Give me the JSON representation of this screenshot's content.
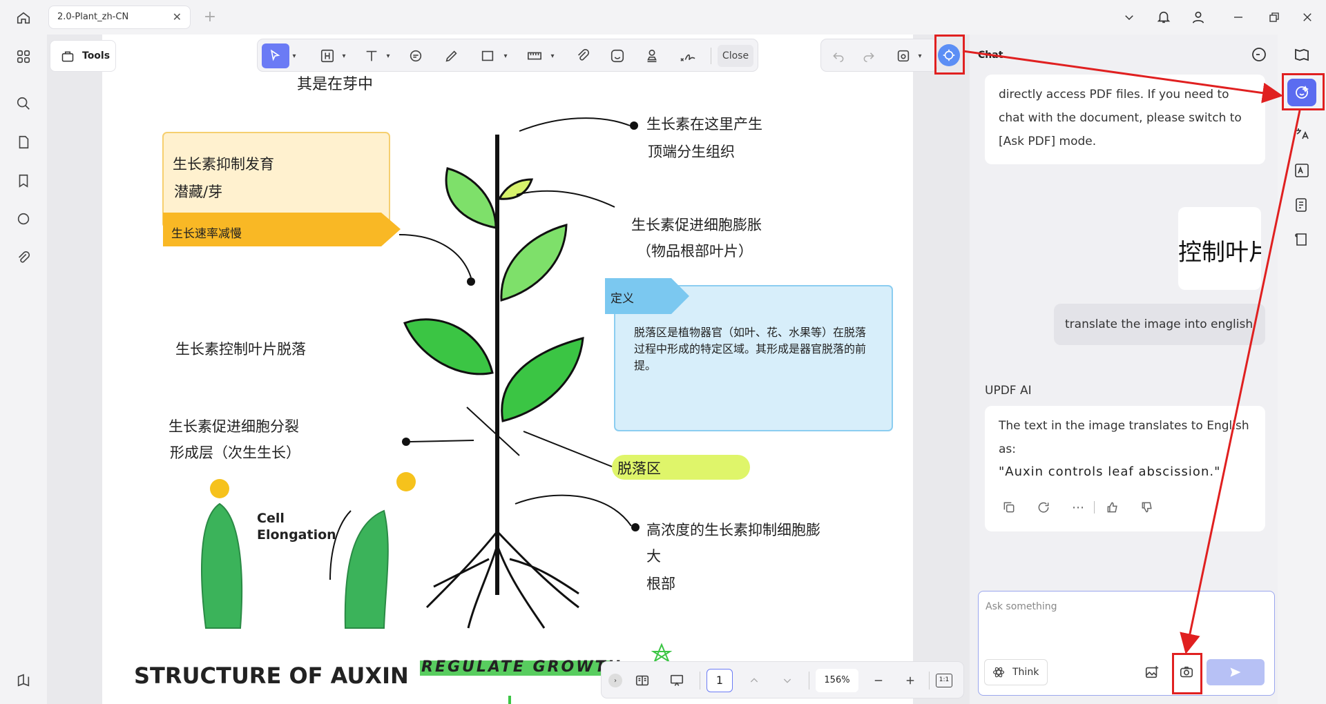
{
  "titlebar": {
    "tab_title": "2.0-Plant_zh-CN",
    "tab_close": "✕",
    "new_tab": "+"
  },
  "toolbar": {
    "tools_label": "Tools",
    "close_label": "Close"
  },
  "chat": {
    "header": "Chat",
    "msg1": "directly access PDF files. If you need to chat with the document, please switch to [Ask PDF] mode.",
    "image_text": "控制叶片",
    "user_msg": "translate the image into english",
    "ai_name": "UPDF AI",
    "ai_reply1": "The text in the image translates to English as:",
    "ai_reply2": "\"Auxin controls leaf abscission.\"",
    "input_placeholder": "Ask something",
    "think_label": "Think"
  },
  "bottombar": {
    "page_number": "1",
    "zoom": "156%",
    "fit_label": "1:1"
  },
  "pdf": {
    "top_text": "其是在芽中",
    "box1_line1": "生长素抑制发育",
    "box1_line2": "潜藏/芽",
    "box1_tag": "生长速率减慢",
    "label_top_r1": "生长素在这里产生",
    "label_top_r2": "顶端分生组织",
    "label_mid_r1": "生长素促进细胞膨胀",
    "label_mid_r2": "（物品根部叶片）",
    "def_tag": "定义",
    "def_text": "脱落区是植物器官（如叶、花、水果等）在脱落过程中形成的特定区域。其形成是器官脱落的前提。",
    "left_mid": "生长素控制叶片脱落",
    "left_low1": "生长素促进细胞分裂",
    "left_low2": "形成层（次生生长）",
    "abscission": "脱落区",
    "root_1": "高浓度的生长素抑制细胞膨",
    "root_2": "大",
    "root_3": "根部",
    "cell_1": "Cell",
    "cell_2": "Elongation",
    "structure": "STRUCTURE OF AUXIN",
    "regulate": "REGULATE GROWTH"
  },
  "colors": {
    "accent": "#5b6cf0",
    "annot_red": "#e02020",
    "yellow_box": "#fff1cf",
    "orange_tag": "#f9b825",
    "def_bg": "#d7eefa",
    "def_tag": "#7bc8f0",
    "lime": "#dff56a",
    "leaf": "#3bc544"
  }
}
